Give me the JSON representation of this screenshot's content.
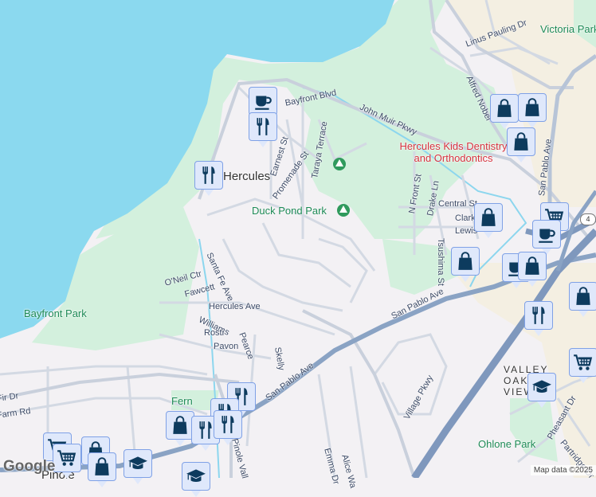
{
  "map": {
    "places": {
      "hercules": "Hercules",
      "valley_oak_views": "VALLEY OAK VIEWS",
      "pinole": "Pinole"
    },
    "parks": {
      "duck_pond": "Duck Pond Park",
      "bayfront": "Bayfront Park",
      "victoria": "Victoria Park",
      "ohlone": "Ohlone Park",
      "fernandez": "Fern"
    },
    "poi": {
      "dentistry": "Hercules Kids Dentistry and Orthodontics"
    },
    "streets": {
      "bayfront_blvd": "Bayfront Blvd",
      "john_muir": "John Muir Pkwy",
      "linus_pauling": "Linus Pauling Dr",
      "alfred_nobel": "Alfred Nobel",
      "san_pablo_north": "San Pablo Ave",
      "san_pablo_main": "San Pablo Ave",
      "san_pablo_sw": "San Pablo Ave",
      "earnest": "Earnest St",
      "promenade": "Promenade St",
      "taraya": "Taraya Terrace",
      "n_front": "N Front St",
      "drake": "Drake Ln",
      "central": "Central St",
      "clark": "Clark",
      "lewis": "Lewis",
      "tsushima": "Tsushima St",
      "santa_fe": "Santa Fe Ave",
      "oneil": "O'Neil Ctr",
      "fawcett": "Fawcett",
      "hercules_ave": "Hercules Ave",
      "williams": "Williams",
      "rosti": "Rosti",
      "pavon": "Pavon",
      "pearce": "Pearce",
      "skelly": "Skelly",
      "village_pkwy": "Village Pkwy",
      "emma": "Emma Dr",
      "alice": "Alice Wa",
      "pinole_valley": "Pinole Vall",
      "pheasant": "Pheasant Dr",
      "partridge": "Partridge Dr",
      "fir": "Fir Dr",
      "farm": "Farm Rd"
    },
    "route_shield": "4",
    "markers": [
      {
        "type": "cafe",
        "icon": "coffee-cup-icon"
      },
      {
        "type": "restaurant",
        "icon": "fork-knife-icon"
      },
      {
        "type": "restaurant",
        "icon": "fork-knife-icon"
      },
      {
        "type": "shopping",
        "icon": "shopping-bag-icon"
      },
      {
        "type": "shopping",
        "icon": "shopping-bag-icon"
      },
      {
        "type": "shopping",
        "icon": "shopping-bag-icon"
      },
      {
        "type": "grocery",
        "icon": "shopping-cart-icon"
      },
      {
        "type": "shopping",
        "icon": "shopping-bag-icon"
      },
      {
        "type": "cafe",
        "icon": "coffee-cup-icon"
      },
      {
        "type": "shopping",
        "icon": "shopping-bag-icon"
      },
      {
        "type": "cafe",
        "icon": "coffee-cup-icon"
      },
      {
        "type": "shopping",
        "icon": "shopping-bag-icon"
      },
      {
        "type": "restaurant",
        "icon": "fork-knife-icon"
      },
      {
        "type": "shopping",
        "icon": "shopping-bag-icon"
      },
      {
        "type": "grocery",
        "icon": "shopping-cart-icon"
      },
      {
        "type": "school",
        "icon": "graduation-cap-icon"
      },
      {
        "type": "restaurant",
        "icon": "fork-knife-icon"
      },
      {
        "type": "restaurant",
        "icon": "fork-knife-icon"
      },
      {
        "type": "shopping",
        "icon": "shopping-bag-icon"
      },
      {
        "type": "restaurant",
        "icon": "fork-knife-icon"
      },
      {
        "type": "restaurant",
        "icon": "fork-knife-icon"
      },
      {
        "type": "grocery",
        "icon": "shopping-cart-icon"
      },
      {
        "type": "grocery",
        "icon": "shopping-cart-icon"
      },
      {
        "type": "shopping",
        "icon": "shopping-bag-icon"
      },
      {
        "type": "shopping",
        "icon": "shopping-bag-icon"
      },
      {
        "type": "school",
        "icon": "graduation-cap-icon"
      },
      {
        "type": "school",
        "icon": "graduation-cap-icon"
      }
    ],
    "logo": "Google",
    "attribution": "Map data ©2025"
  }
}
